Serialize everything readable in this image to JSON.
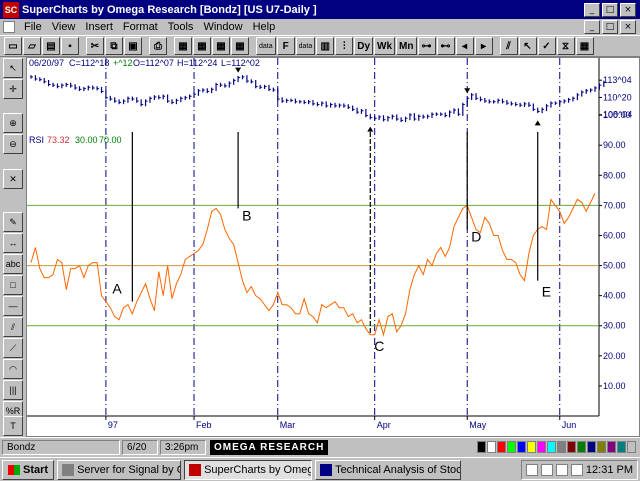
{
  "window": {
    "title": "SuperCharts by Omega Research  [Bondz]  [US U7-Daily ]",
    "app_icon": "SC"
  },
  "menu": [
    "File",
    "View",
    "Insert",
    "Format",
    "Tools",
    "Window",
    "Help"
  ],
  "toolbar": {
    "data_a": "data",
    "data_b": "data",
    "dy": "Dy",
    "wk": "Wk",
    "mn": "Mn",
    "icons": [
      "new-icon",
      "open-icon",
      "save-icon",
      "print-icon",
      "cut-icon",
      "copy-icon",
      "paste-icon",
      "grid-icon",
      "bar-chart-icon",
      "pointer-icon"
    ]
  },
  "chart_data": {
    "type": "line",
    "instrument": "US U7-Daily",
    "price_readout": {
      "date": "06/20/97",
      "close": "C=112^18",
      "change": "+^12",
      "open": "O=112^07",
      "high": "H=112^24",
      "low": "L=112^02"
    },
    "price_axis_labels": [
      "113^04",
      "110^20",
      "108^04"
    ],
    "price_ticks": [
      113.125,
      110.625,
      108.125
    ],
    "price_range": [
      106.2,
      114.6
    ],
    "indicator": {
      "name": "RSI",
      "value": "73.32",
      "lower": "30.00",
      "upper": "70.00"
    },
    "rsi_ylim": [
      0,
      115
    ],
    "rsi_ticks": [
      "100.00",
      "90.00",
      "80.00",
      "70.00",
      "60.00",
      "50.00",
      "40.00",
      "30.00",
      "20.00",
      "10.00"
    ],
    "reference_lines": [
      70,
      50,
      30
    ],
    "x_labels": [
      {
        "label": "97",
        "index": 17
      },
      {
        "label": "Feb",
        "index": 37
      },
      {
        "label": "Mar",
        "index": 56
      },
      {
        "label": "Apr",
        "index": 78
      },
      {
        "label": "May",
        "index": 99
      },
      {
        "label": "Jun",
        "index": 120
      }
    ],
    "month_separators": [
      17,
      37,
      56,
      78,
      99,
      120
    ],
    "price_closes": [
      113.6,
      113.3,
      113.2,
      112.9,
      112.5,
      112.4,
      112.2,
      112.4,
      112.5,
      112.3,
      112.0,
      111.8,
      111.9,
      112.1,
      112.0,
      111.9,
      111.5,
      110.6,
      110.4,
      110.1,
      109.9,
      110.1,
      110.5,
      110.4,
      110.1,
      109.6,
      110.1,
      110.5,
      110.7,
      110.6,
      110.8,
      110.1,
      109.9,
      110.2,
      110.5,
      110.6,
      110.8,
      111.1,
      111.6,
      111.7,
      111.5,
      111.8,
      112.5,
      112.4,
      112.3,
      112.7,
      113.1,
      113.5,
      113.6,
      113.0,
      112.9,
      112.2,
      112.1,
      112.2,
      111.8,
      111.7,
      110.4,
      110.1,
      110.2,
      110.2,
      110.0,
      110.0,
      109.9,
      110.0,
      109.7,
      109.6,
      109.8,
      109.4,
      109.6,
      109.4,
      109.5,
      109.4,
      109.2,
      108.9,
      108.5,
      108.7,
      108.0,
      107.7,
      107.6,
      107.8,
      107.4,
      107.7,
      107.9,
      107.5,
      107.3,
      107.6,
      108.1,
      107.5,
      107.9,
      107.8,
      107.9,
      108.2,
      108.2,
      108.2,
      108.0,
      108.5,
      108.8,
      108.2,
      109.6,
      110.5,
      111.0,
      110.5,
      110.3,
      110.1,
      110.0,
      110.0,
      110.2,
      110.0,
      109.8,
      109.7,
      109.6,
      109.5,
      109.7,
      109.5,
      108.9,
      108.6,
      108.9,
      109.4,
      109.8,
      109.8,
      110.0,
      110.1,
      110.3,
      110.5,
      111.0,
      111.4,
      111.6,
      111.7,
      112.0,
      112.4,
      112.8
    ],
    "rsi_values": [
      51,
      56,
      49,
      46,
      46,
      47,
      52,
      51,
      42,
      49,
      49,
      50,
      46,
      50,
      51,
      51,
      40,
      38,
      36,
      33,
      32,
      36,
      37,
      34,
      38,
      41,
      44,
      39,
      35,
      48,
      40,
      50,
      39,
      44,
      47,
      52,
      53,
      54,
      55,
      57,
      62,
      68,
      69,
      67,
      62,
      59,
      57,
      51,
      45,
      41,
      43,
      40,
      39,
      37,
      35,
      37,
      41,
      37,
      37,
      36,
      34,
      34,
      39,
      34,
      33,
      31,
      37,
      36,
      37,
      38,
      36,
      36,
      33,
      34,
      31,
      32,
      29,
      27,
      27,
      32,
      27,
      33,
      34,
      28,
      30,
      34,
      42,
      47,
      50,
      47,
      52,
      50,
      54,
      56,
      53,
      56,
      63,
      66,
      69,
      70,
      66,
      62,
      61,
      66,
      64,
      60,
      60,
      55,
      52,
      52,
      51,
      47,
      45,
      54,
      60,
      62,
      63,
      62,
      72,
      70,
      68,
      64,
      66,
      69,
      72,
      71,
      68,
      71,
      74
    ],
    "annotations": [
      {
        "label": "A",
        "index": 23,
        "rsi_level": 38
      },
      {
        "label": "B",
        "index": 47,
        "rsi_level": 69
      },
      {
        "label": "C",
        "index": 77,
        "rsi_level": 27
      },
      {
        "label": "D",
        "index": 99,
        "rsi_level": 62
      },
      {
        "label": "E",
        "index": 115,
        "rsi_level": 45
      }
    ],
    "arrows": [
      {
        "index": 47,
        "dir": "down"
      },
      {
        "index": 77,
        "dir": "up"
      },
      {
        "index": 99,
        "dir": "down"
      },
      {
        "index": 115,
        "dir": "up"
      }
    ],
    "colors": {
      "price": "#000080",
      "rsi": "#ff6600",
      "ref_upper": "#66aa33",
      "ref_mid": "#cc9933",
      "ref_lower": "#66aa33",
      "separator": "#000080",
      "axis_text": "#000080",
      "rsi_value": "#cc3333",
      "readout_change": "#008000"
    }
  },
  "status": {
    "symbol": "Bondz",
    "date": "6/20",
    "time": "3:26pm",
    "brand": "OMEGA RESEARCH"
  },
  "taskbar": {
    "start": "Start",
    "items": [
      "Server for Signal by Omeg...",
      "SuperCharts by Omeg...",
      "Technical Analysis of Stoc..."
    ],
    "clock": "12:31 PM"
  },
  "palette": [
    "#000000",
    "#ffffff",
    "#ff0000",
    "#00ff00",
    "#0000ff",
    "#ffff00",
    "#ff00ff",
    "#00ffff",
    "#808080",
    "#800000",
    "#008000",
    "#000080",
    "#808000",
    "#800080",
    "#008080",
    "#c0c0c0"
  ]
}
